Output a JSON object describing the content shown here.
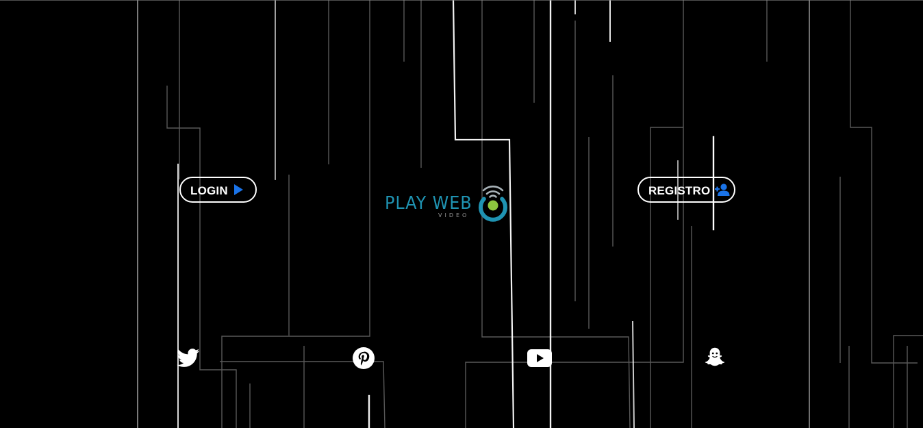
{
  "nav": {
    "login_label": "LOGIN",
    "register_label": "REGISTRO"
  },
  "logo": {
    "title": "PLAY WEB",
    "subtitle": "VIDEO"
  },
  "social": [
    {
      "name": "twitter-icon"
    },
    {
      "name": "pinterest-icon"
    },
    {
      "name": "youtube-icon"
    },
    {
      "name": "snapchat-icon"
    }
  ],
  "colors": {
    "background": "#000000",
    "accent_blue": "#1a73e8",
    "logo_teal": "#1f93b2",
    "logo_green": "#8cc63f",
    "foreground": "#ffffff"
  }
}
